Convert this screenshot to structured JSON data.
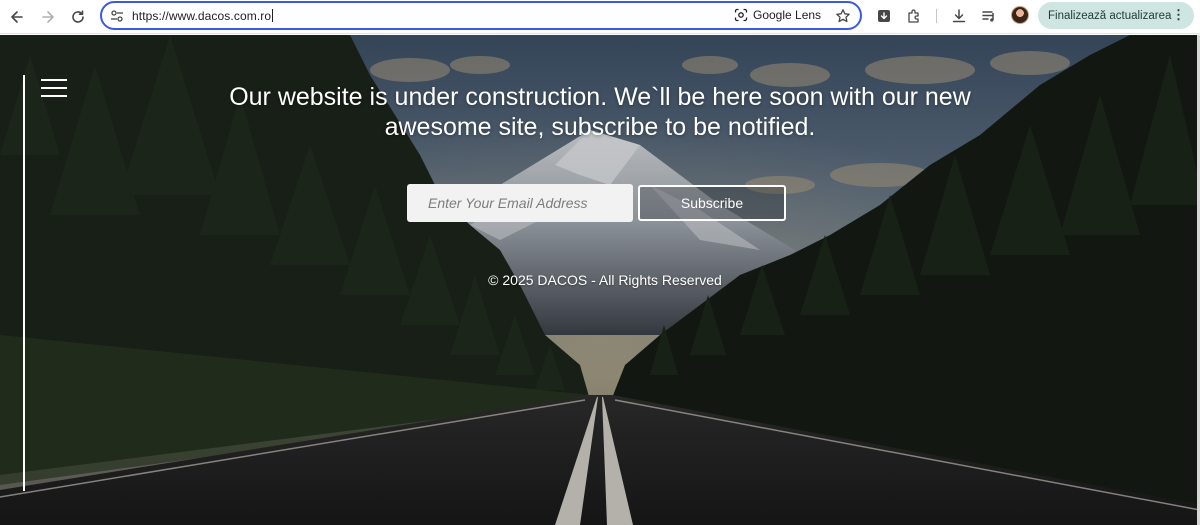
{
  "browser": {
    "url": "https://www.dacos.com.ro",
    "lens_label": "Google Lens",
    "update_label": "Finalizează actualizarea"
  },
  "page": {
    "headline": "Our website is under construction. We`ll be here soon with our new awesome site, subscribe to be notified.",
    "email_placeholder": "Enter Your Email Address",
    "subscribe_label": "Subscribe",
    "copyright": "© 2025 DACOS - All Rights Reserved"
  },
  "icons": {
    "back": "arrow-left-icon",
    "forward": "arrow-right-icon",
    "reload": "reload-icon",
    "site_info": "tune-icon",
    "lens": "google-lens-icon",
    "bookmark": "star-icon",
    "install": "download-box-icon",
    "extensions": "puzzle-icon",
    "downloads": "download-icon",
    "media": "media-queue-icon",
    "menu": "hamburger-icon",
    "more": "more-vert-icon"
  },
  "colors": {
    "omnibox_focus": "#3b5bdb",
    "update_button": "#cfe5e1",
    "input_bg": "#f2f2f2",
    "text_light": "#ffffff"
  }
}
